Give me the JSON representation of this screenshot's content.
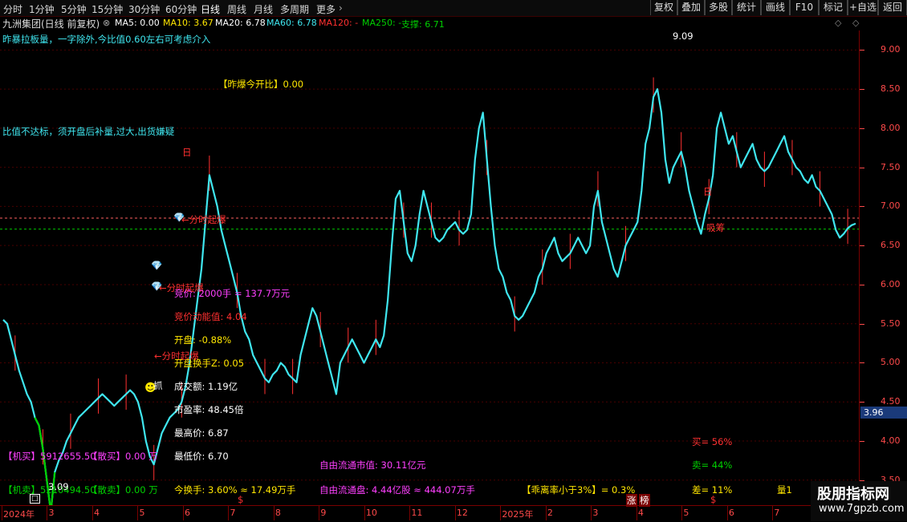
{
  "top": {
    "stock_title": "九洲集团(日线 前复权)",
    "periods": [
      "分时",
      "1分钟",
      "5分钟",
      "15分钟",
      "30分钟",
      "60分钟",
      "日线",
      "周线",
      "月线",
      "多周期",
      "更多"
    ],
    "buttons": [
      "复权",
      "叠加",
      "多股",
      "统计",
      "画线",
      "F10",
      "标记",
      "+自选",
      "返回"
    ]
  },
  "ma": {
    "ma5": "MA5: 0.00",
    "ma10": "MA10: 3.67",
    "ma20": "MA20: 6.78",
    "ma60": "MA60: 6.78",
    "ma120": "MA120: -",
    "ma250": "MA250: -",
    "support": "支撑: 6.71"
  },
  "annotations": {
    "line1": "昨暴拉板量，一字除外,今比值0.60左右可考虑介入",
    "zb_ratio": "【昨爆今开比】0.00",
    "line2": "比值不达标，须开盘后补量,过大,出货嫌疑",
    "fen1": "←分时起爆",
    "fen2": "←分时起爆",
    "fen3": "←分时起爆",
    "bid_price": "竞价: 2000手 = 137.7万元",
    "bid_power": "竞价动能值: 4.04",
    "open": "开盘: -0.88%",
    "open_turn": "开盘换手Z: 0.05",
    "amount": "成交额: 1.19亿",
    "pe": "市盈率: 48.45倍",
    "high": "最高价: 6.87",
    "low": "最低价: 6.70",
    "jm_buy": "【机买】5912655.50",
    "sb_buy": "【散买】0.00 万",
    "jm_sell": "【机卖】5210494.50",
    "sb_sell": "【散卖】0.00 万",
    "turnover": "今换手: 3.60% ≈ 17.49万手",
    "float_cap": "自由流通市值: 30.11亿元",
    "float_shares": "自由流通盘: 4.44亿股 ≈ 444.07万手",
    "deviation": "【乖离率小于3%】= 0.3%",
    "buy_pct": "买= 56%",
    "sell_pct": "卖= 44%",
    "diff_pct": "差= 11%",
    "liang": "量1",
    "xichou": "吸筹",
    "max_label": "9.09",
    "min_label": "3.09",
    "ri1": "日",
    "ri2": "日",
    "zhang": "涨",
    "bang": "榜",
    "zhua": "抓",
    "s_mark": "$"
  },
  "price_marker": "3.96",
  "watermark": {
    "title": "股朋指标网",
    "url": "www.7gpzb.com"
  },
  "colors": {
    "candle_up": "#ff3030",
    "candle_down": "#00e5e5",
    "main_line": "#3fe6ef",
    "ma_green": "#00d000",
    "support_line": "#00cc00",
    "ref_line": "#ff6060",
    "accent_yellow": "#ffe600",
    "accent_magenta": "#ff40ff"
  },
  "chart_data": {
    "type": "line",
    "title": "九洲集团(日线 前复权)",
    "xlabel": "",
    "ylabel": "",
    "ylim": [
      3.2,
      9.25
    ],
    "yticks": [
      "9.00",
      "8.50",
      "8.00",
      "7.50",
      "7.00",
      "6.50",
      "6.00",
      "5.50",
      "5.00",
      "4.50",
      "4.00",
      "3.50"
    ],
    "xticks": [
      "2024年",
      "3",
      "4",
      "5",
      "6",
      "7",
      "8",
      "9",
      "10",
      "11",
      "12",
      "2025年",
      "2",
      "3",
      "4",
      "5",
      "6",
      "7",
      "8"
    ],
    "support_level": 6.71,
    "ref_level": 6.85,
    "series": [
      {
        "values": [
          5.55,
          5.5,
          5.3,
          5.1,
          4.9,
          4.75,
          4.6,
          4.5,
          4.3,
          4.2,
          3.9,
          3.5,
          3.09,
          3.6,
          3.75,
          3.85,
          4.0,
          4.1,
          4.2,
          4.3,
          4.35,
          4.4,
          4.45,
          4.5,
          4.55,
          4.6,
          4.55,
          4.5,
          4.45,
          4.5,
          4.55,
          4.6,
          4.65,
          4.6,
          4.5,
          4.3,
          4.0,
          3.8,
          3.7,
          3.9,
          4.1,
          4.2,
          4.3,
          4.35,
          4.4,
          4.5,
          4.7,
          5.0,
          5.4,
          5.8,
          6.2,
          6.8,
          7.4,
          7.2,
          7.0,
          6.7,
          6.5,
          6.3,
          6.1,
          5.9,
          5.6,
          5.4,
          5.3,
          5.1,
          5.0,
          4.9,
          4.8,
          4.75,
          4.85,
          4.9,
          5.0,
          4.95,
          4.85,
          4.8,
          4.75,
          5.1,
          5.3,
          5.5,
          5.7,
          5.6,
          5.4,
          5.2,
          5.0,
          4.8,
          4.6,
          5.0,
          5.1,
          5.2,
          5.3,
          5.2,
          5.1,
          5.0,
          5.1,
          5.2,
          5.3,
          5.2,
          5.35,
          5.8,
          6.5,
          7.1,
          7.2,
          6.8,
          6.4,
          6.3,
          6.5,
          6.9,
          7.2,
          7.0,
          6.8,
          6.6,
          6.55,
          6.6,
          6.7,
          6.75,
          6.8,
          6.7,
          6.65,
          6.7,
          6.9,
          7.6,
          8.0,
          8.2,
          7.6,
          7.0,
          6.5,
          6.2,
          6.1,
          5.9,
          5.8,
          5.6,
          5.55,
          5.6,
          5.7,
          5.8,
          5.9,
          6.1,
          6.2,
          6.4,
          6.5,
          6.6,
          6.4,
          6.3,
          6.35,
          6.4,
          6.5,
          6.6,
          6.5,
          6.4,
          6.5,
          7.0,
          7.2,
          6.8,
          6.6,
          6.4,
          6.2,
          6.1,
          6.3,
          6.5,
          6.6,
          6.7,
          6.8,
          7.2,
          7.8,
          8.0,
          8.4,
          8.5,
          8.2,
          7.6,
          7.3,
          7.5,
          7.6,
          7.7,
          7.5,
          7.2,
          7.0,
          6.8,
          6.65,
          6.9,
          7.1,
          7.4,
          8.0,
          8.2,
          8.0,
          7.8,
          7.9,
          7.7,
          7.5,
          7.6,
          7.7,
          7.8,
          7.6,
          7.5,
          7.45,
          7.5,
          7.6,
          7.7,
          7.8,
          7.9,
          7.7,
          7.6,
          7.5,
          7.45,
          7.35,
          7.3,
          7.4,
          7.25,
          7.2,
          7.1,
          7.0,
          6.9,
          6.7,
          6.6,
          6.65,
          6.72,
          6.76,
          6.78
        ]
      }
    ]
  }
}
